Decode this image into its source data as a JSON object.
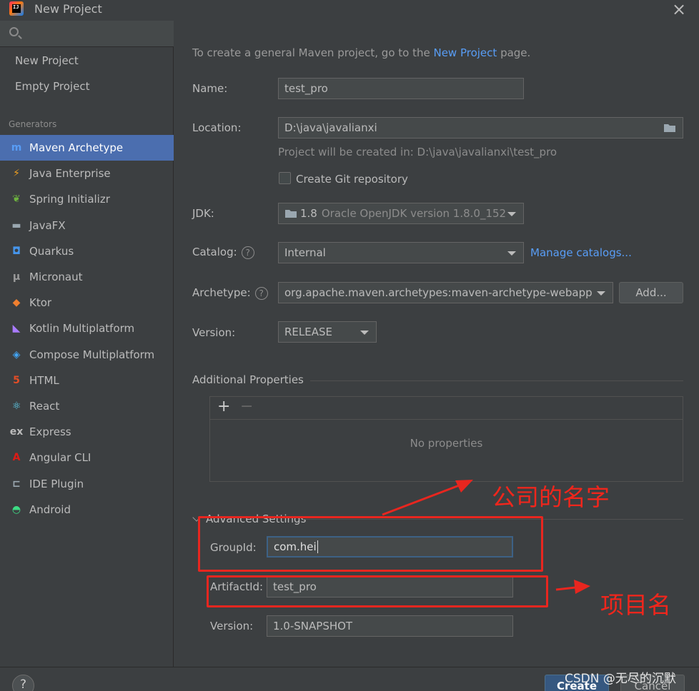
{
  "window": {
    "title": "New Project",
    "close_glyph": "×"
  },
  "sidebar": {
    "search_placeholder": "",
    "top_items": [
      "New Project",
      "Empty Project"
    ],
    "generators_label": "Generators",
    "generators": [
      {
        "label": "Maven Archetype",
        "icon": "maven-icon",
        "glyph": "m",
        "color": "#589df6",
        "selected": true
      },
      {
        "label": "Java Enterprise",
        "icon": "java-enterprise-icon",
        "glyph": "⚡",
        "color": "#f0a020"
      },
      {
        "label": "Spring Initializr",
        "icon": "spring-icon",
        "glyph": "❦",
        "color": "#6db33f"
      },
      {
        "label": "JavaFX",
        "icon": "javafx-folder-icon",
        "glyph": "▬",
        "color": "#9aa7b0"
      },
      {
        "label": "Quarkus",
        "icon": "quarkus-icon",
        "glyph": "◘",
        "color": "#4695eb"
      },
      {
        "label": "Micronaut",
        "icon": "micronaut-icon",
        "glyph": "μ",
        "color": "#9a9a9a"
      },
      {
        "label": "Ktor",
        "icon": "ktor-icon",
        "glyph": "◆",
        "color": "#f07f2f"
      },
      {
        "label": "Kotlin Multiplatform",
        "icon": "kotlin-icon",
        "glyph": "◣",
        "color": "#a97bff"
      },
      {
        "label": "Compose Multiplatform",
        "icon": "compose-icon",
        "glyph": "◈",
        "color": "#42a5f5"
      },
      {
        "label": "HTML",
        "icon": "html5-icon",
        "glyph": "5",
        "color": "#e44d26"
      },
      {
        "label": "React",
        "icon": "react-icon",
        "glyph": "⚛",
        "color": "#61dafb"
      },
      {
        "label": "Express",
        "icon": "express-icon",
        "glyph": "ex",
        "color": "#bbbbbb"
      },
      {
        "label": "Angular CLI",
        "icon": "angular-icon",
        "glyph": "A",
        "color": "#dd1b16"
      },
      {
        "label": "IDE Plugin",
        "icon": "plugin-icon",
        "glyph": "⊏",
        "color": "#9aa7b0"
      },
      {
        "label": "Android",
        "icon": "android-icon",
        "glyph": "◓",
        "color": "#3ddc84"
      }
    ]
  },
  "form": {
    "intro_prefix": "To create a general Maven project, go to the ",
    "intro_link": "New Project",
    "intro_suffix": " page.",
    "name_label": "Name:",
    "name_value": "test_pro",
    "location_label": "Location:",
    "location_value": "D:\\java\\javalianxi",
    "location_hint": "Project will be created in: D:\\java\\javalianxi\\test_pro",
    "git_label": "Create Git repository",
    "jdk_label": "JDK:",
    "jdk_version": "1.8",
    "jdk_detail": "Oracle OpenJDK version 1.8.0_152",
    "catalog_label": "Catalog:",
    "catalog_value": "Internal",
    "manage_catalogs": "Manage catalogs...",
    "archetype_label": "Archetype:",
    "archetype_value": "org.apache.maven.archetypes:maven-archetype-webapp",
    "add_button": "Add...",
    "version_label": "Version:",
    "version_value": "RELEASE",
    "help_glyph": "?"
  },
  "additional_properties": {
    "title": "Additional Properties",
    "add_glyph": "+",
    "remove_glyph": "−",
    "empty_text": "No properties"
  },
  "advanced": {
    "title": "Advanced Settings",
    "groupid_label": "GroupId:",
    "groupid_value": "com.hei",
    "artifactid_label": "ArtifactId:",
    "artifactid_value": "test_pro",
    "version_label": "Version:",
    "version_value": "1.0-SNAPSHOT"
  },
  "annotations": {
    "company_name": "公司的名字",
    "project_name": "项目名",
    "color": "#e8261f"
  },
  "footer": {
    "help_glyph": "?",
    "create": "Create",
    "cancel": "Cancel",
    "watermark": "CSDN @无尽的沉默"
  }
}
